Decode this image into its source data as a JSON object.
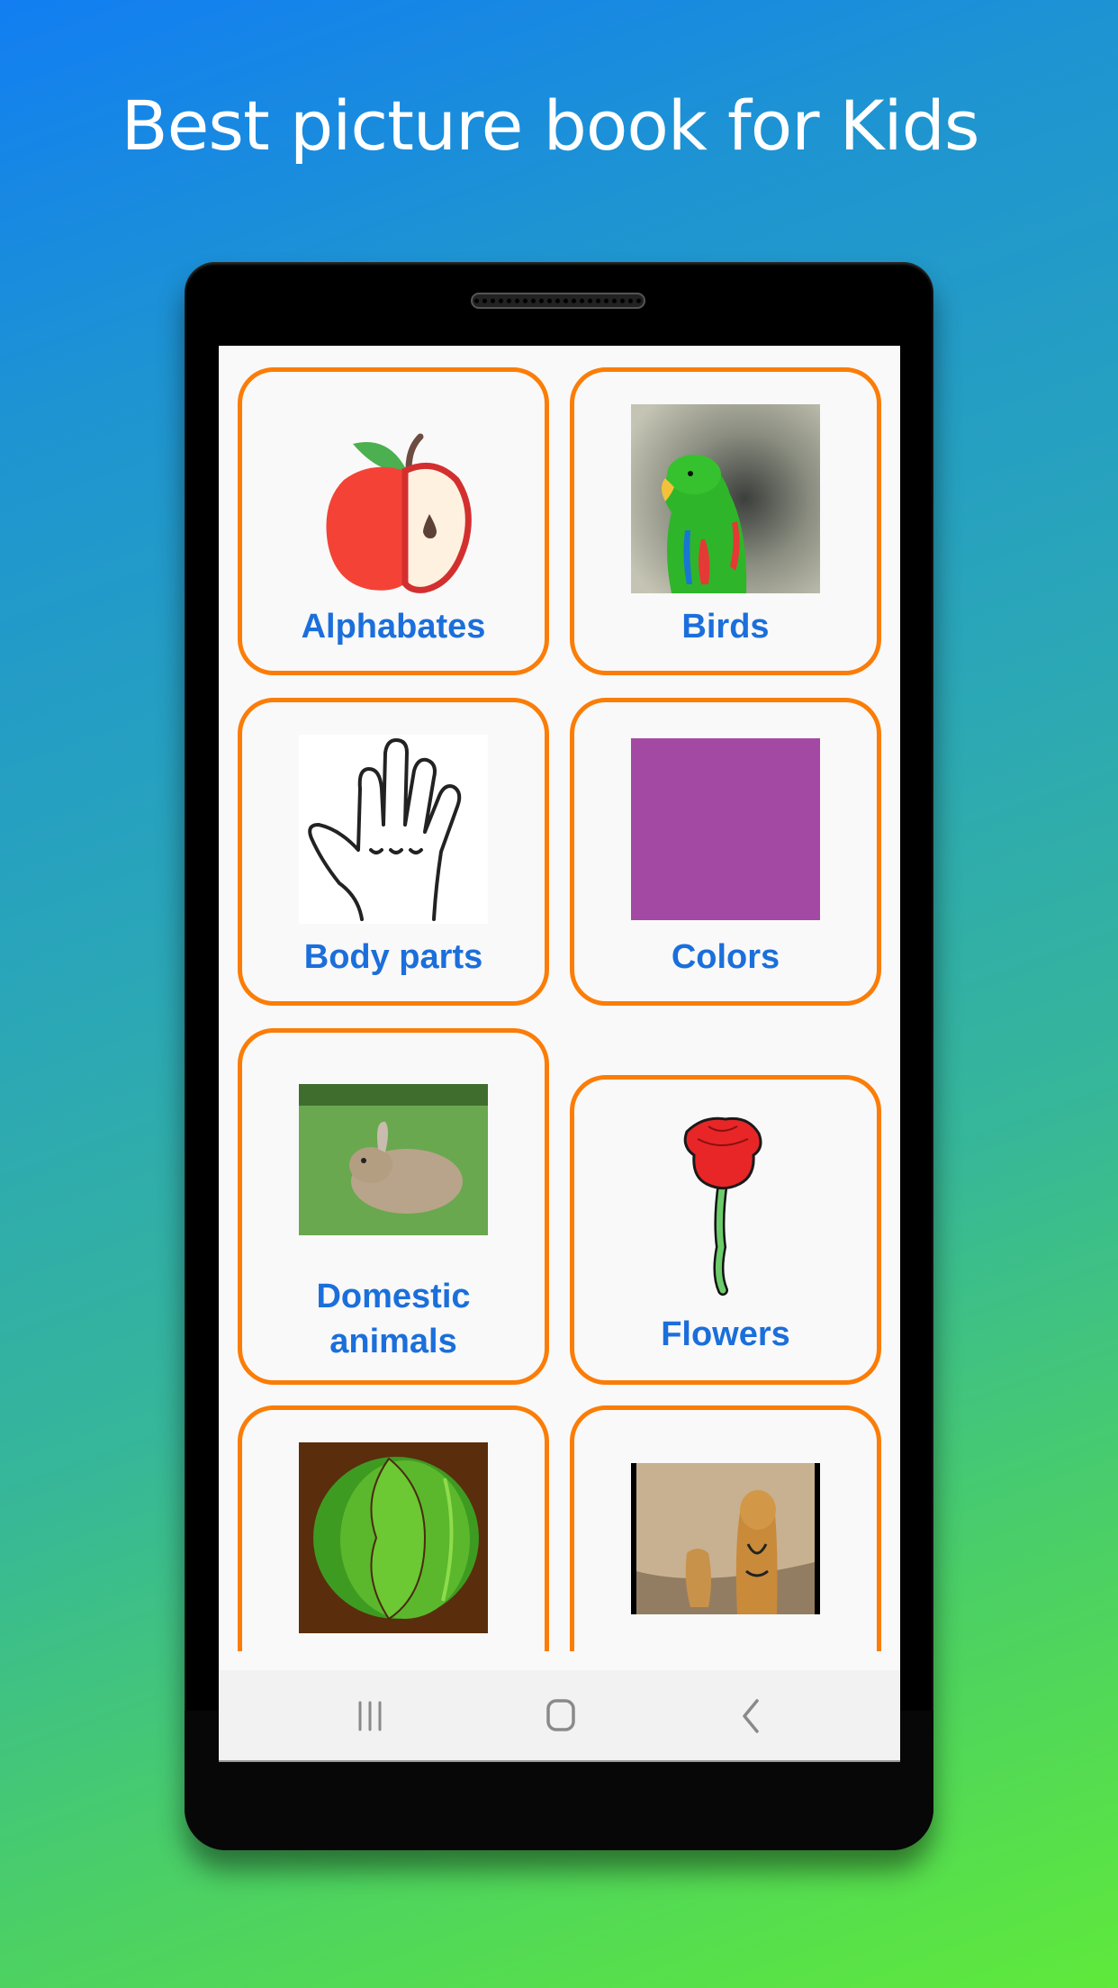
{
  "headline": "Best picture book for Kids",
  "colors": {
    "card_border": "#fb7d07",
    "label_text": "#1b6fdb",
    "screen_bg": "#f9f9f9",
    "color_swatch": "#a349a4"
  },
  "categories": [
    {
      "label": "Alphabates",
      "image": "apple-icon"
    },
    {
      "label": "Birds",
      "image": "parrot-photo"
    },
    {
      "label": "Body parts",
      "image": "hand-drawing"
    },
    {
      "label": "Colors",
      "image": "purple-swatch"
    },
    {
      "label": "Domestic animals",
      "label_lines": [
        "Domestic",
        "animals"
      ],
      "image": "rabbit-photo"
    },
    {
      "label": "Flowers",
      "image": "rose-drawing"
    },
    {
      "label": "",
      "image": "cabbage-drawing"
    },
    {
      "label": "",
      "image": "tiger-photo"
    }
  ],
  "navbar": {
    "recents": "recent-apps-icon",
    "home": "home-icon",
    "back": "back-icon"
  }
}
